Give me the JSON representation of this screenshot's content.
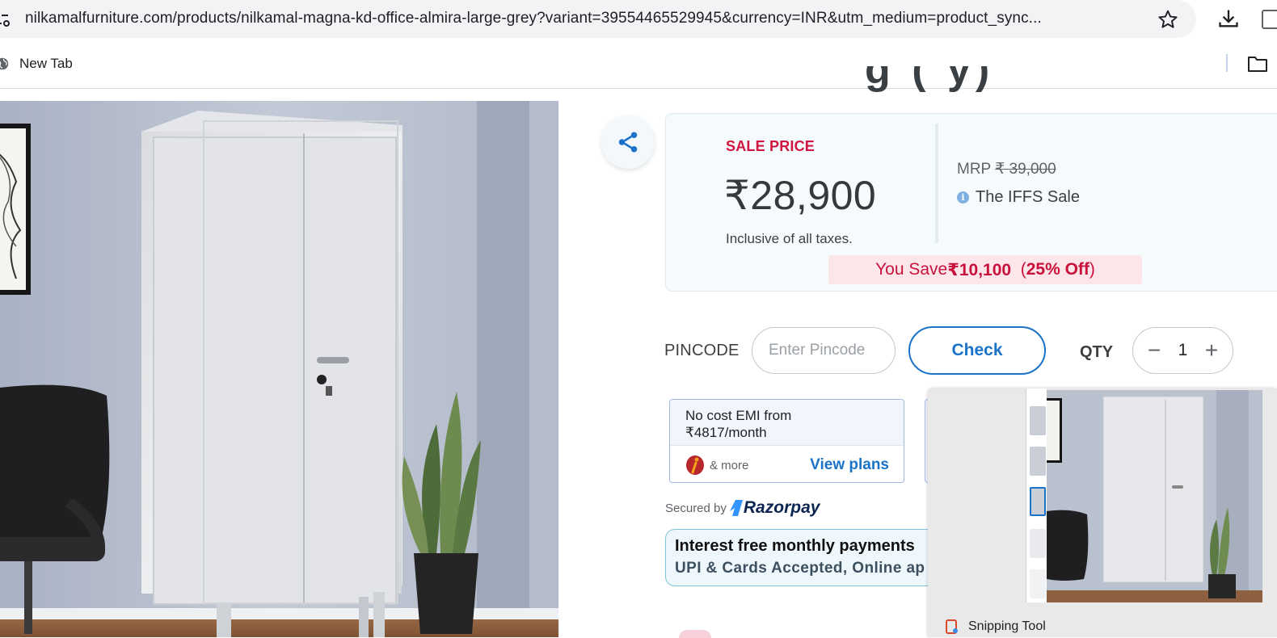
{
  "browser": {
    "url": "nilkamalfurniture.com/products/nilkamal-magna-kd-office-almira-large-grey?variant=39554465529945&currency=INR&utm_medium=product_sync...",
    "bookmark_label": "New Tab"
  },
  "product": {
    "title_fragment": "g (  y)",
    "sale_label": "SALE PRICE",
    "sale_price": "₹28,900",
    "tax_note": "Inclusive of all taxes.",
    "mrp_label": "MRP",
    "mrp_value": "₹ 39,000",
    "offer_name": "The IFFS Sale",
    "you_save_label": "You Save",
    "you_save_amount": "₹10,100",
    "you_save_pct": "25% Off"
  },
  "delivery": {
    "pincode_label": "PINCODE",
    "pincode_placeholder": "Enter Pincode",
    "check_label": "Check",
    "qty_label": "QTY",
    "qty_value": "1",
    "minus": "−",
    "plus": "+"
  },
  "emi": {
    "line1": "No cost EMI from",
    "line2": "₹4817/month",
    "more": "& more",
    "view_plans": "View plans",
    "secured_by": "Secured by",
    "provider": "Razorpay"
  },
  "interest_banner": {
    "line1": "Interest free monthly payments",
    "line2": "UPI & Cards Accepted, Online ap"
  },
  "snipping_tool": {
    "app_name": "Snipping Tool"
  },
  "colors": {
    "accent_blue": "#1a73c8",
    "sale_red": "#d11641",
    "price_dark": "#34393e"
  }
}
